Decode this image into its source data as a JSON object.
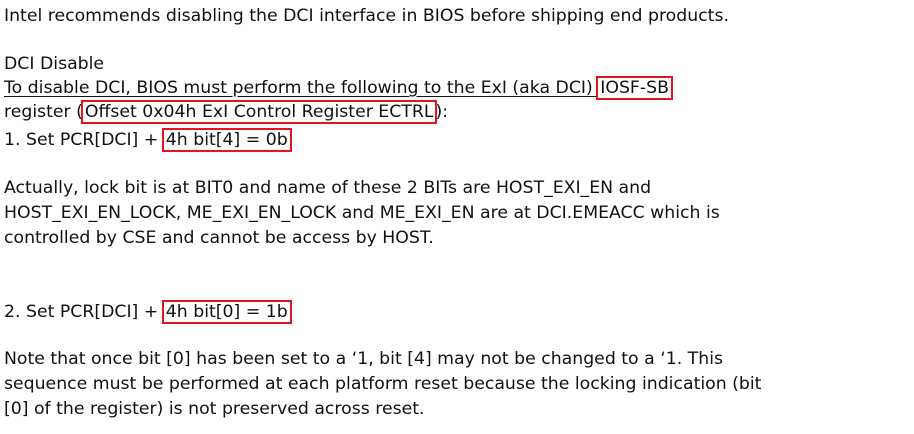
{
  "document": {
    "intro": "Intel recommends disabling the DCI interface in BIOS before shipping end products.",
    "section_title": "DCI Disable",
    "para1": {
      "line1_a": "To disable DCI, BIOS must perform the following to the ExI (aka DCI) ",
      "line1_highlight": "IOSF-SB",
      "line2_a": "register (",
      "line2_highlight": "Offset 0x04h ExI Control Register ECTRL",
      "line2_b": "):"
    },
    "step1": {
      "prefix": "1. Set PCR[DCI] + ",
      "highlight": "4h bit[4] = 0b"
    },
    "note1": {
      "line1": "Actually, lock bit is at BIT0 and name of these 2 BITs are HOST_EXI_EN and",
      "line2": "HOST_EXI_EN_LOCK, ME_EXI_EN_LOCK and ME_EXI_EN are at DCI.EMEACC which is",
      "line3": "controlled by CSE and cannot be access by HOST."
    },
    "step2": {
      "prefix": "2. Set PCR[DCI] + ",
      "highlight": "4h bit[0] = 1b"
    },
    "note2": {
      "line1": "Note that once bit [0] has been set to a ‘1, bit [4] may not be changed to a ‘1. This",
      "line2": "sequence must be performed at each platform reset because the locking indication (bit",
      "line3": "[0] of the register) is not preserved across reset."
    },
    "highlight_color": "#e8141c"
  }
}
